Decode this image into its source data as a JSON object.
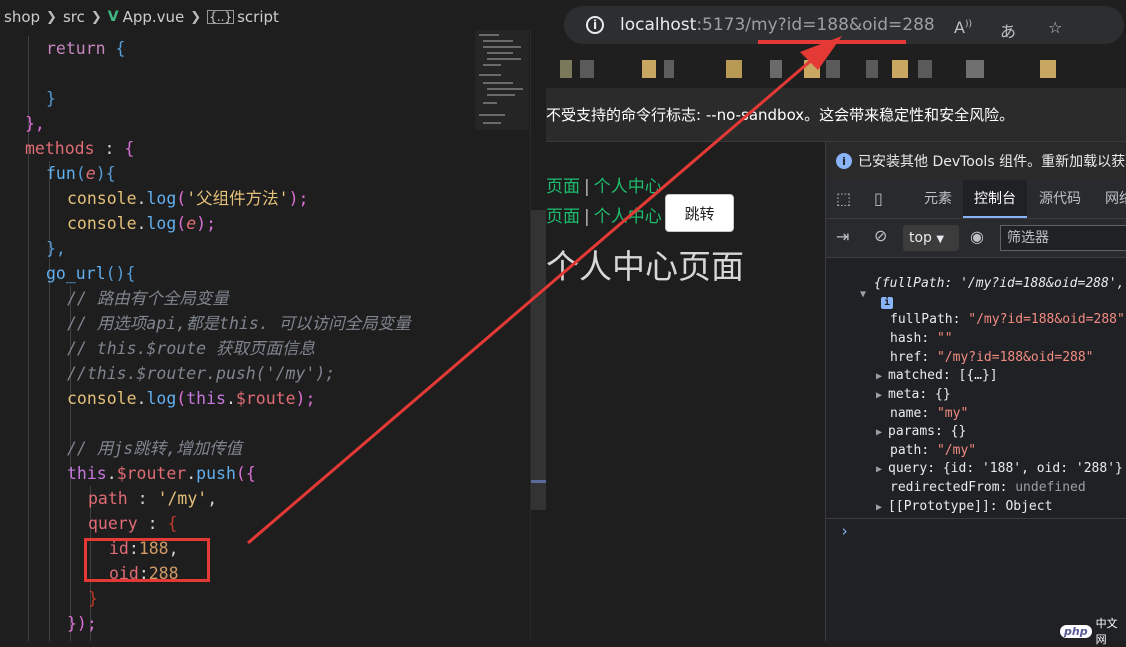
{
  "editor": {
    "breadcrumb": {
      "folder1": "shop",
      "folder2": "src",
      "file": "App.vue",
      "symbol": "script"
    },
    "lines": {
      "l1_kw": "return",
      "l1_br": "{",
      "l2_br": "}",
      "l3_br": "},",
      "l4_prop": "methods",
      "l4_colon": " : ",
      "l4_br": "{",
      "l5_fn": "fun",
      "l5_p1": "(",
      "l5_arg": "e",
      "l5_p2": "){",
      "l6_obj": "console",
      "l6_dot": ".",
      "l6_fn": "log",
      "l6_p1": "(",
      "l6_str": "'父组件方法'",
      "l6_p2": ");",
      "l7_obj": "console",
      "l7_dot": ".",
      "l7_fn": "log",
      "l7_p1": "(",
      "l7_arg": "e",
      "l7_p2": ");",
      "l8_br": "},",
      "l9_fn": "go_url",
      "l9_rest": "(){",
      "c1": "// 路由有个全局变量",
      "c2": "// 用选项api,都是this. 可以访问全局变量",
      "c3": "// this.$route 获取页面信息",
      "c4": "//this.$router.push('/my');",
      "l10_obj": "console",
      "l10_dot": ".",
      "l10_fn": "log",
      "l10_p1": "(",
      "l10_this": "this",
      "l10_dot2": ".",
      "l10_route": "$route",
      "l10_p2": ");",
      "c5": "// 用js跳转,增加传值",
      "l11_this": "this",
      "l11_dot": ".",
      "l11_router": "$router",
      "l11_dot2": ".",
      "l11_fn": "push",
      "l11_p": "({",
      "l12_key": "path",
      "l12_colon": " : ",
      "l12_str": "'/my'",
      "l12_comma": ",",
      "l13_key": "query",
      "l13_colon": " : ",
      "l13_br": "{",
      "l14_key": "id",
      "l14_colon": ":",
      "l14_num": "188",
      "l14_comma": ",",
      "l15_key": "oid",
      "l15_colon": ":",
      "l15_num": "288",
      "l16_br": "}",
      "l17_br": "});"
    }
  },
  "browser": {
    "url_host": "localhost",
    "url_path": ":5173/my?id=188&oid=288",
    "warning": "不受支持的命令行标志: --no-sandbox。这会带来稳定性和安全风险。",
    "nav1_link1": "页面",
    "nav1_bar": "|",
    "nav1_link2": "个人中心",
    "nav2_link1": "页面",
    "nav2_bar": "|",
    "nav2_link2": "个人中心",
    "jump_button": "跳转",
    "page_heading": "个人中心页面"
  },
  "devtools": {
    "info": "已安装其他 DevTools 组件。重新加载以获取",
    "tabs": [
      "元素",
      "控制台",
      "源代码",
      "网络"
    ],
    "context": "top",
    "filter_placeholder": "筛选器",
    "console": {
      "summary": "{fullPath: '/my?id=188&oid=288', ",
      "badge": "i",
      "fullPath_k": "fullPath",
      "fullPath_v": "\"/my?id=188&oid=288\"",
      "hash_k": "hash",
      "hash_v": "\"\"",
      "href_k": "href",
      "href_v": "\"/my?id=188&oid=288\"",
      "matched_k": "matched",
      "matched_v": "[{…}]",
      "meta_k": "meta",
      "meta_v": "{}",
      "name_k": "name",
      "name_v": "\"my\"",
      "params_k": "params",
      "params_v": "{}",
      "path_k": "path",
      "path_v": "\"/my\"",
      "query_k": "query",
      "query_v": "{id: '188', oid: '288'}",
      "redirectedFrom_k": "redirectedFrom",
      "redirectedFrom_v": "undefined",
      "proto_k": "[[Prototype]]",
      "proto_v": "Object",
      "prompt": "›"
    }
  },
  "watermark": {
    "php": "php",
    "text": "中文网"
  },
  "colors": {
    "annotation_red": "#e53935",
    "vue_green": "#41b883",
    "link_green": "#1ebd6e"
  }
}
